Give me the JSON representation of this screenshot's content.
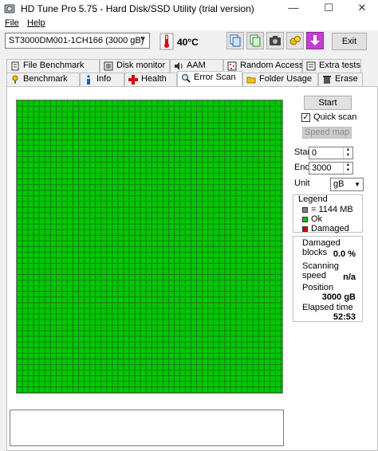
{
  "window": {
    "title": "HD Tune Pro 5.75 - Hard Disk/SSD Utility (trial version)",
    "minimize": "—",
    "maximize": "☐",
    "close": "✕"
  },
  "menu": [
    {
      "label": "File"
    },
    {
      "label": "Help"
    }
  ],
  "toolbar": {
    "drive": "ST3000DM001-1CH166 (3000 gB)",
    "temperature": "40°C",
    "exit_label": "Exit"
  },
  "tabs_top": [
    {
      "label": "File Benchmark",
      "icon": "file-benchmark-icon"
    },
    {
      "label": "Disk monitor",
      "icon": "disk-monitor-icon"
    },
    {
      "label": "AAM",
      "icon": "speaker-icon"
    },
    {
      "label": "Random Access",
      "icon": "random-access-icon"
    },
    {
      "label": "Extra tests",
      "icon": "extra-tests-icon"
    }
  ],
  "tabs_bottom": [
    {
      "label": "Benchmark",
      "icon": "benchmark-icon"
    },
    {
      "label": "Info",
      "icon": "info-icon"
    },
    {
      "label": "Health",
      "icon": "health-cross-icon"
    },
    {
      "label": "Error Scan",
      "icon": "magnifier-icon",
      "active": true
    },
    {
      "label": "Folder Usage",
      "icon": "folder-icon"
    },
    {
      "label": "Erase",
      "icon": "erase-icon"
    }
  ],
  "scan": {
    "start_label": "Start",
    "quick_scan_label": "Quick scan",
    "quick_scan_checked": true,
    "speed_map_label": "Speed map",
    "start_field_label": "Start",
    "start_value": "0",
    "end_field_label": "End",
    "end_value": "3000",
    "unit_label": "Unit",
    "unit_value": "gB"
  },
  "legend": {
    "title": "Legend",
    "block_size": "= 1144 MB",
    "ok": "Ok",
    "damaged": "Damaged",
    "colors": {
      "block": "#808080",
      "ok": "#00c800",
      "damaged": "#c80000"
    }
  },
  "stats": {
    "damaged_blocks_label": "Damaged blocks",
    "damaged_blocks_value": "0.0 %",
    "scanning_speed_label": "Scanning speed",
    "scanning_speed_value": "n/a",
    "position_label": "Position",
    "position_value": "3000 gB",
    "elapsed_label": "Elapsed time",
    "elapsed_value": "52:53"
  },
  "block_grid": {
    "status": "ok",
    "color": "#00c800",
    "grid_color": "#1a6e1a"
  }
}
